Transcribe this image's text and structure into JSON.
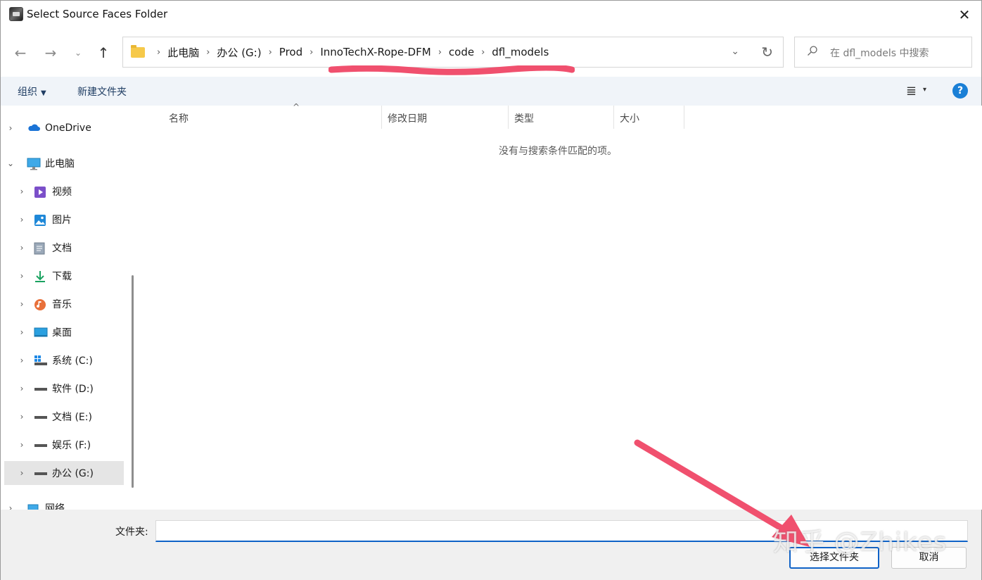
{
  "window": {
    "title": "Select Source Faces Folder",
    "close_glyph": "✕"
  },
  "nav": {
    "back_glyph": "←",
    "forward_glyph": "→",
    "recent_glyph": "⌄",
    "up_glyph": "↑",
    "breadcrumb": [
      "此电脑",
      "办公 (G:)",
      "Prod",
      "InnoTechX-Rope-DFM",
      "code",
      "dfl_models"
    ],
    "separator": "›",
    "dropdown_glyph": "⌄",
    "refresh_glyph": "↻",
    "annotation_color": "#f0506e"
  },
  "search": {
    "placeholder": "在 dfl_models 中搜索"
  },
  "commandbar": {
    "organize": "组织",
    "new_folder": "新建文件夹",
    "view_glyph": "≣",
    "view_caret": "▾",
    "help_glyph": "?"
  },
  "sidebar": {
    "items": [
      {
        "label": "OneDrive",
        "icon": "cloud-icon",
        "chevron": "›"
      },
      {
        "label": "此电脑",
        "icon": "pc-icon",
        "chevron": "⌄"
      },
      {
        "label": "视频",
        "icon": "video-icon",
        "chevron": "›"
      },
      {
        "label": "图片",
        "icon": "pictures-icon",
        "chevron": "›"
      },
      {
        "label": "文档",
        "icon": "documents-icon",
        "chevron": "›"
      },
      {
        "label": "下载",
        "icon": "download-icon",
        "chevron": "›"
      },
      {
        "label": "音乐",
        "icon": "music-icon",
        "chevron": "›"
      },
      {
        "label": "桌面",
        "icon": "desktop-icon",
        "chevron": "›"
      },
      {
        "label": "系统 (C:)",
        "icon": "system-drive-icon",
        "chevron": "›"
      },
      {
        "label": "软件 (D:)",
        "icon": "drive-icon",
        "chevron": "›"
      },
      {
        "label": "文档 (E:)",
        "icon": "drive-icon",
        "chevron": "›"
      },
      {
        "label": "娱乐 (F:)",
        "icon": "drive-icon",
        "chevron": "›"
      },
      {
        "label": "办公 (G:)",
        "icon": "drive-icon",
        "chevron": "›",
        "selected": true
      },
      {
        "label": "网络",
        "icon": "network-icon",
        "chevron": "›"
      }
    ]
  },
  "filelist": {
    "columns": [
      "名称",
      "修改日期",
      "类型",
      "大小"
    ],
    "sort_glyph": "^",
    "empty_message": "没有与搜索条件匹配的项。"
  },
  "bottom": {
    "folder_label": "文件夹:",
    "folder_value": "",
    "select_button": "选择文件夹",
    "cancel_button": "取消"
  },
  "overlay": {
    "watermark": "知乎 @Zhikes",
    "arrow_color": "#f0506e"
  }
}
